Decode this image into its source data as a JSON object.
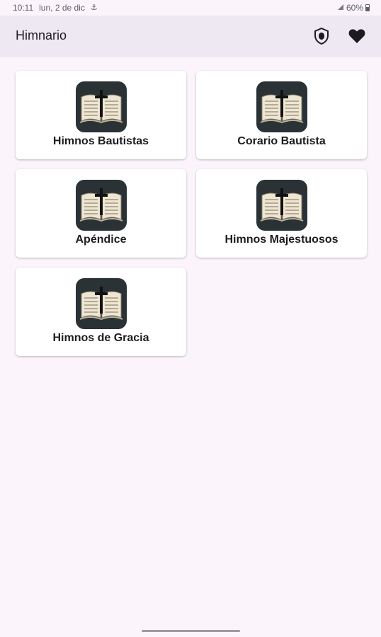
{
  "status": {
    "time": "10:11",
    "date": "lun, 2 de dic",
    "battery": "60%"
  },
  "app_bar": {
    "title": "Himnario",
    "actions": [
      "shield-icon",
      "heart-icon"
    ]
  },
  "hymnals": [
    {
      "label": "Himnos Bautistas",
      "icon": "bible-icon"
    },
    {
      "label": "Corario Bautista",
      "icon": "bible-icon"
    },
    {
      "label": "Apéndice",
      "icon": "bible-icon"
    },
    {
      "label": "Himnos Majestuosos",
      "icon": "bible-icon"
    },
    {
      "label": "Himnos de Gracia",
      "icon": "bible-icon"
    }
  ],
  "colors": {
    "background": "#fbf4fb",
    "app_bar": "#eee8f2",
    "icon_tile": "#2b3236",
    "cross": "#111111"
  }
}
